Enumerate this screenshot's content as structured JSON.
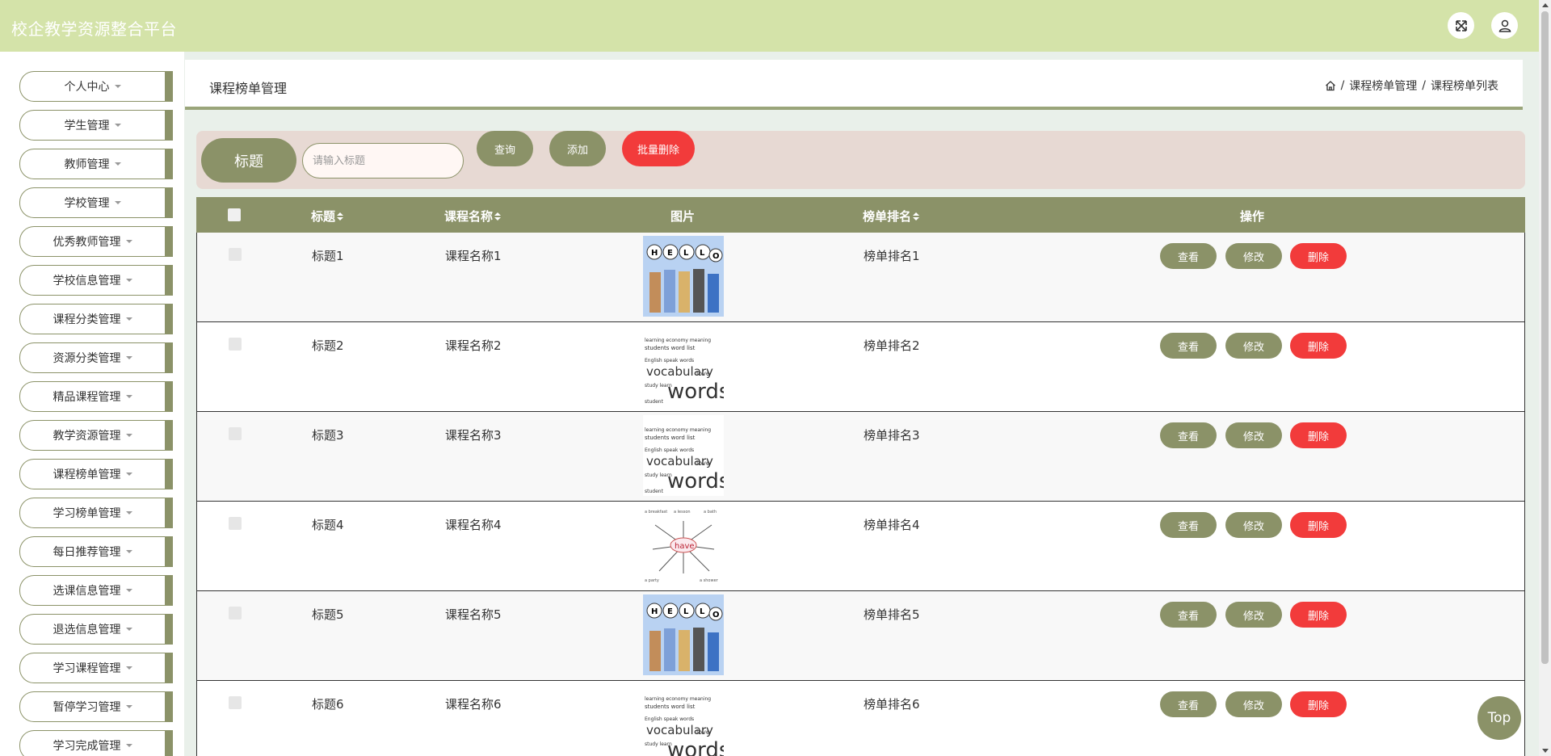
{
  "app": {
    "title": "校企教学资源整合平台"
  },
  "header_icons": [
    "fullscreen-icon",
    "user-icon"
  ],
  "sidebar": {
    "items": [
      {
        "label": "个人中心"
      },
      {
        "label": "学生管理"
      },
      {
        "label": "教师管理"
      },
      {
        "label": "学校管理"
      },
      {
        "label": "优秀教师管理"
      },
      {
        "label": "学校信息管理"
      },
      {
        "label": "课程分类管理"
      },
      {
        "label": "资源分类管理"
      },
      {
        "label": "精品课程管理"
      },
      {
        "label": "教学资源管理"
      },
      {
        "label": "课程榜单管理"
      },
      {
        "label": "学习榜单管理"
      },
      {
        "label": "每日推荐管理"
      },
      {
        "label": "选课信息管理"
      },
      {
        "label": "退选信息管理"
      },
      {
        "label": "学习课程管理"
      },
      {
        "label": "暂停学习管理"
      },
      {
        "label": "学习完成管理"
      }
    ]
  },
  "page": {
    "title": "课程榜单管理",
    "breadcrumb": [
      "课程榜单管理",
      "课程榜单列表"
    ],
    "breadcrumb_sep": "/"
  },
  "search": {
    "label": "标题",
    "placeholder": "请输入标题",
    "value": "",
    "query_btn": "查询",
    "add_btn": "添加",
    "batch_delete_btn": "批量删除"
  },
  "table": {
    "columns": [
      "标题",
      "课程名称",
      "图片",
      "榜单排名",
      "操作"
    ],
    "rows": [
      {
        "title": "标题1",
        "course": "课程名称1",
        "image": "hello-kids",
        "rank": "榜单排名1"
      },
      {
        "title": "标题2",
        "course": "课程名称2",
        "image": "vocabulary-words",
        "rank": "榜单排名2"
      },
      {
        "title": "标题3",
        "course": "课程名称3",
        "image": "vocabulary-words",
        "rank": "榜单排名3"
      },
      {
        "title": "标题4",
        "course": "课程名称4",
        "image": "have-mindmap",
        "rank": "榜单排名4"
      },
      {
        "title": "标题5",
        "course": "课程名称5",
        "image": "hello-kids",
        "rank": "榜单排名5"
      },
      {
        "title": "标题6",
        "course": "课程名称6",
        "image": "vocabulary-words",
        "rank": "榜单排名6"
      }
    ],
    "actions": {
      "view": "查看",
      "edit": "修改",
      "delete": "删除"
    }
  },
  "top_button": "Top",
  "colors": {
    "header_bg": "#d4e3a9",
    "accent": "#8b9268",
    "danger": "#f23b3b",
    "search_bg": "#e7d9d3"
  }
}
